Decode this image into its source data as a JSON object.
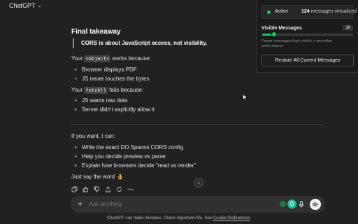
{
  "header": {
    "model_name": "ChatGPT"
  },
  "message": {
    "heading": "Final takeaway",
    "quote": "CORS is about JavaScript access, not visibility.",
    "section1": {
      "prefix": "Your",
      "code": "<object>",
      "suffix": "works because:"
    },
    "section1_bullets": [
      "Browser displays PDF",
      "JS never touches the bytes"
    ],
    "section2": {
      "prefix": "Your",
      "code": "fetch()",
      "suffix": "fails because:"
    },
    "section2_bullets": [
      "JS wants raw data",
      "Server didn't explicitly allow it"
    ],
    "offer_intro": "If you want, I can:",
    "offer_bullets": [
      "Write the exact DO Spaces CORS config",
      "Help you decide preview vs parse",
      "Explain how browsers decide \"read vs render\""
    ],
    "closing": "Just say the word 👌"
  },
  "message_actions": [
    "copy-icon",
    "thumbs-up-icon",
    "thumbs-down-icon",
    "share-icon",
    "regenerate-icon",
    "more-icon"
  ],
  "composer": {
    "placeholder": "Ask anything"
  },
  "footer": {
    "disclaimer": "ChatGPT can make mistakes. Check important info. See",
    "link": "Cookie Preferences",
    "end": "."
  },
  "extension": {
    "status_label": "Active",
    "count": "124",
    "count_label": "messages virtualized",
    "visible_label": "Visible Messages",
    "visible_value": "10",
    "slider_fraction": 0.13,
    "hint": "Fewer messages kept visible = smoother performance.",
    "restore_button": "Restore All Current Messages",
    "accent_color": "#22c55e"
  }
}
